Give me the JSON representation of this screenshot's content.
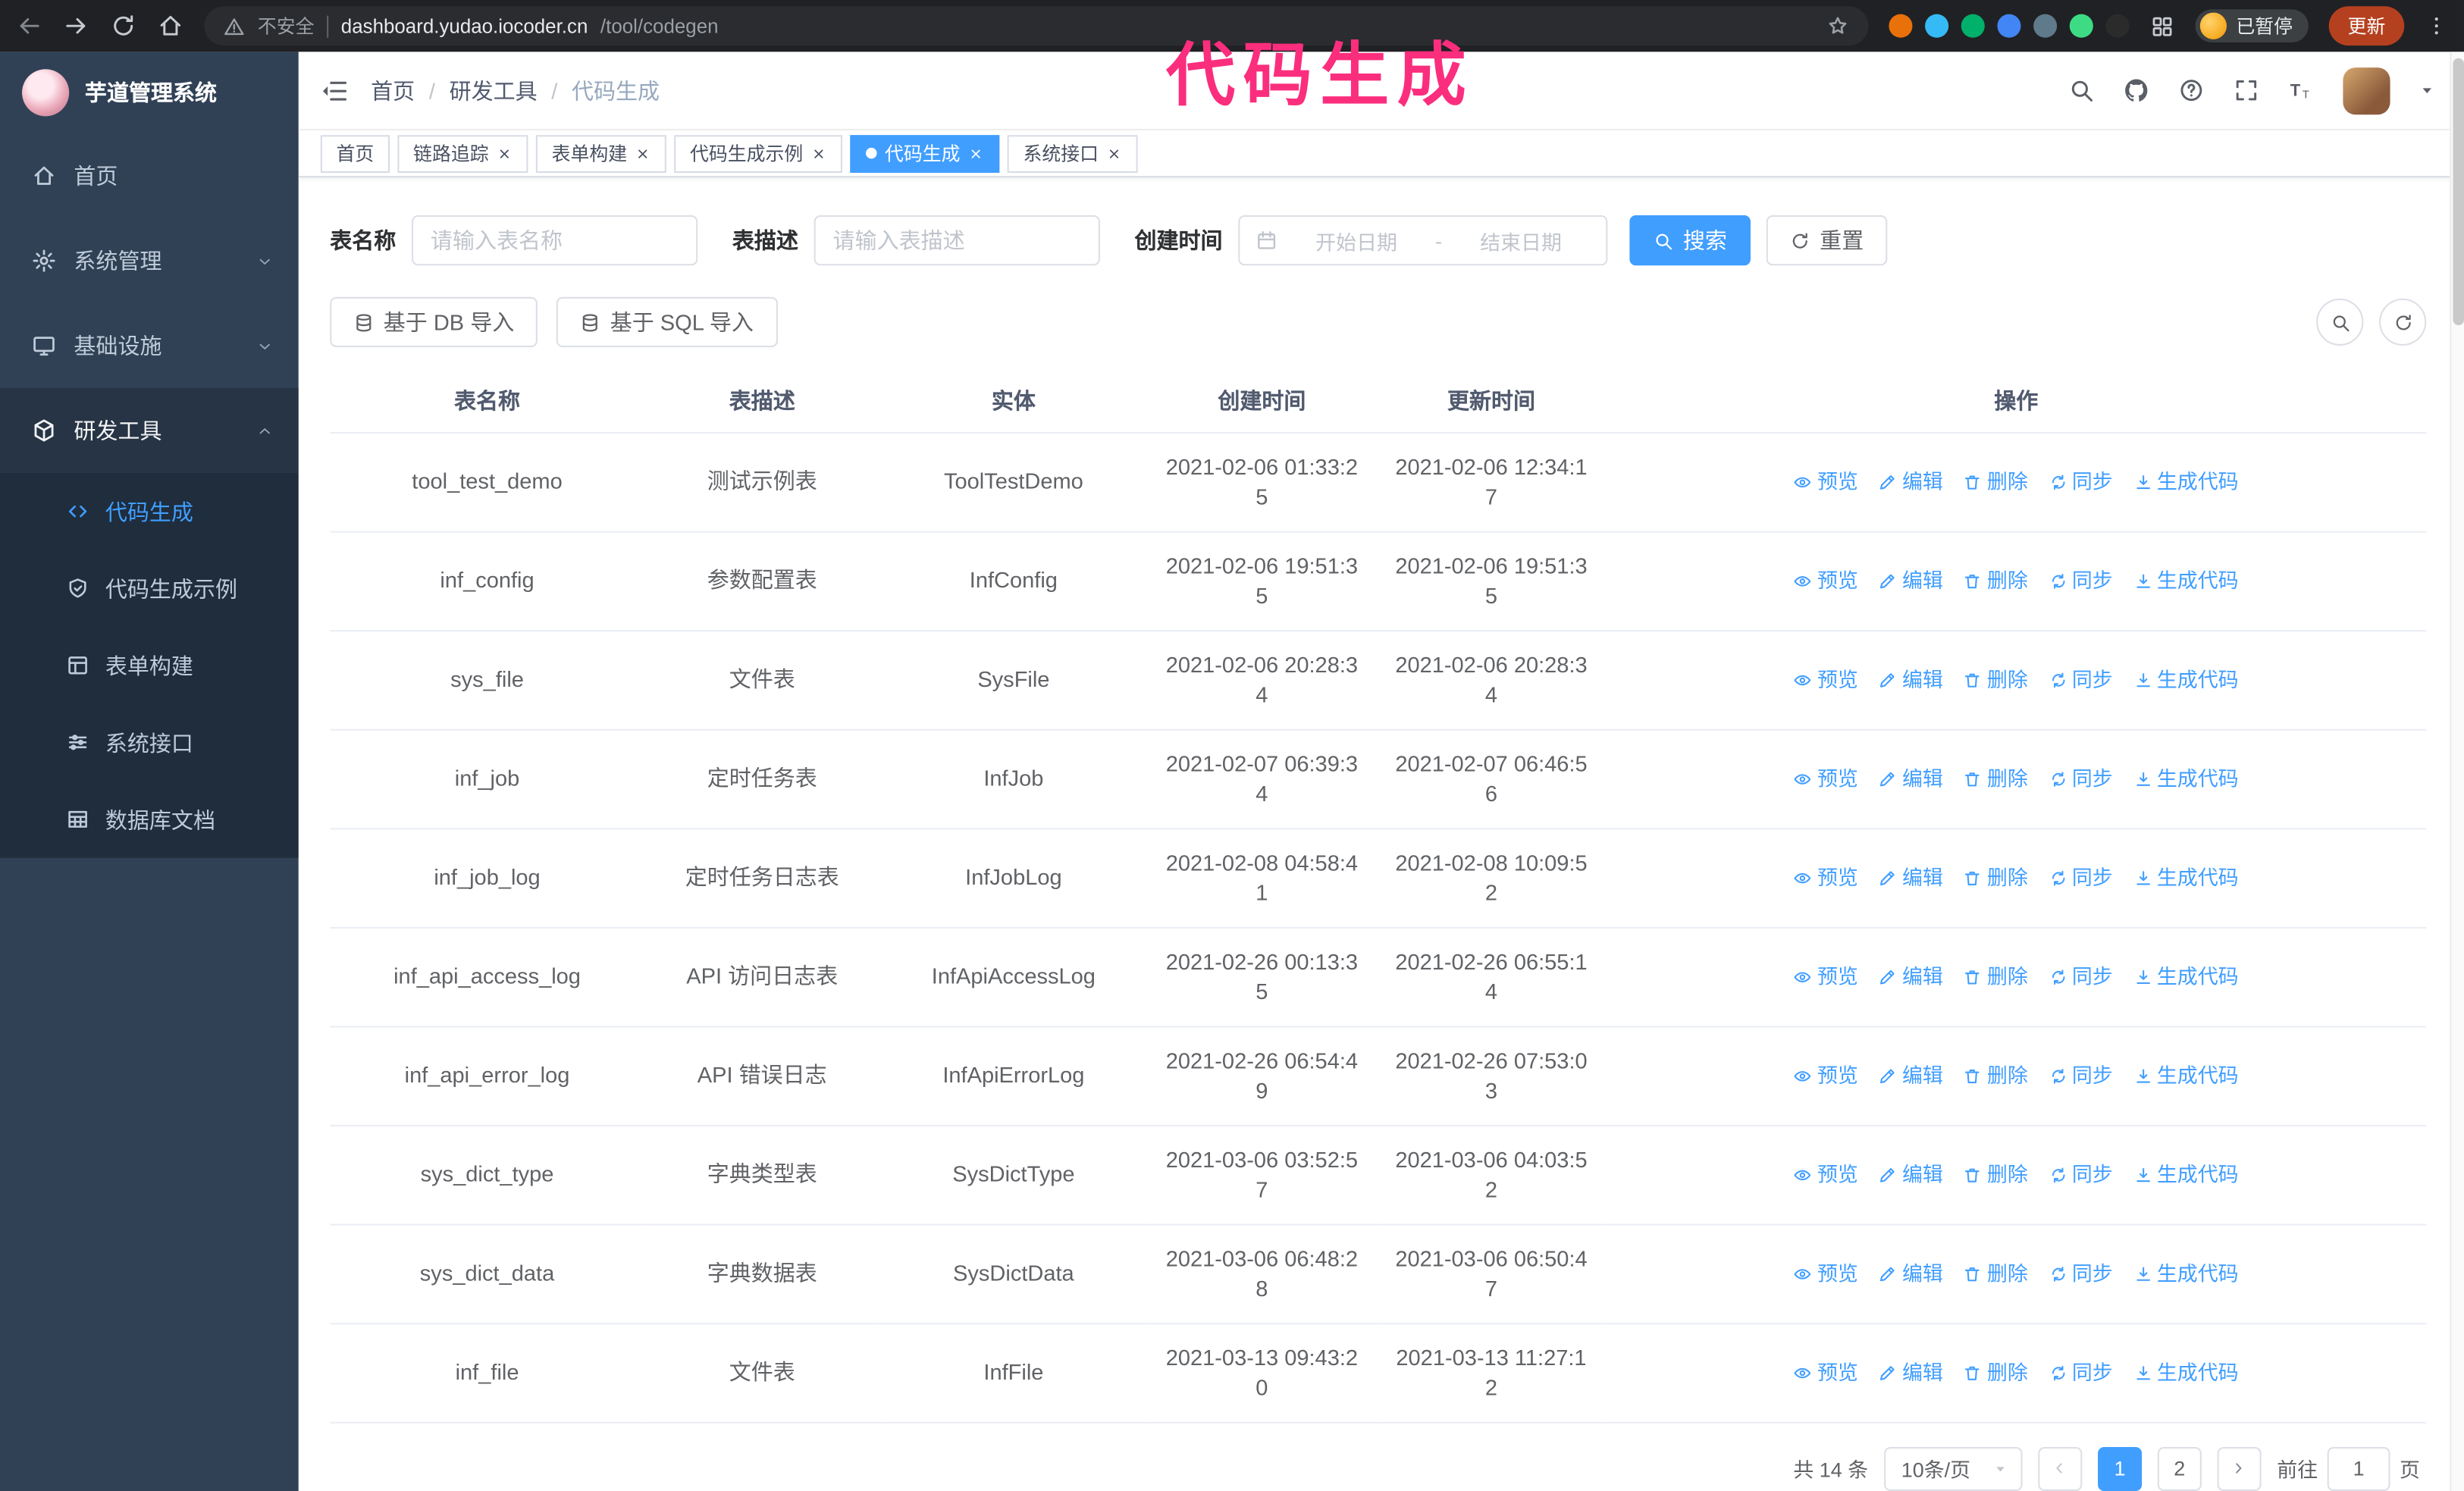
{
  "colors": {
    "accent": "#409eff",
    "sidebar_bg": "#304156",
    "submenu_bg": "#1f2d3d",
    "annotation": "#fb2e7e",
    "update_button_bg": "#b5401f"
  },
  "browser": {
    "security_label": "不安全",
    "url_host": "dashboard.yudao.iocoder.cn",
    "url_path": "/tool/codegen",
    "extensions": [
      {
        "name": "extension-icon",
        "color": "#e8710a"
      },
      {
        "name": "extension-icon",
        "color": "#35baf6"
      },
      {
        "name": "extension-icon",
        "color": "#00b06b"
      },
      {
        "name": "extension-icon",
        "color": "#4285f4"
      },
      {
        "name": "extension-icon",
        "color": "#5f7a8a"
      },
      {
        "name": "extension-icon",
        "color": "#3ddc84"
      },
      {
        "name": "extension-icon",
        "color": "#2b2b2b"
      }
    ],
    "profile_chip_label": "已暂停",
    "update_button_label": "更新"
  },
  "annotation": {
    "text": "代码生成",
    "color": "#fb2e7e"
  },
  "sidebar": {
    "logo_title": "芋道管理系统",
    "items": [
      {
        "icon": "home-icon",
        "label": "首页",
        "expandable": false,
        "expanded": false
      },
      {
        "icon": "gear-icon",
        "label": "系统管理",
        "expandable": true,
        "expanded": false
      },
      {
        "icon": "monitor-icon",
        "label": "基础设施",
        "expandable": true,
        "expanded": false
      },
      {
        "icon": "tools-icon",
        "label": "研发工具",
        "expandable": true,
        "expanded": true
      }
    ],
    "sub_items": [
      {
        "icon": "code-icon",
        "label": "代码生成",
        "active": true
      },
      {
        "icon": "example-icon",
        "label": "代码生成示例",
        "active": false
      },
      {
        "icon": "form-icon",
        "label": "表单构建",
        "active": false
      },
      {
        "icon": "api-icon",
        "label": "系统接口",
        "active": false
      },
      {
        "icon": "dbdoc-icon",
        "label": "数据库文档",
        "active": false
      }
    ]
  },
  "header": {
    "breadcrumb": [
      "首页",
      "研发工具",
      "代码生成"
    ],
    "separator": "/"
  },
  "tabs": [
    {
      "label": "首页",
      "closable": false,
      "active": false
    },
    {
      "label": "链路追踪",
      "closable": true,
      "active": false
    },
    {
      "label": "表单构建",
      "closable": true,
      "active": false
    },
    {
      "label": "代码生成示例",
      "closable": true,
      "active": false
    },
    {
      "label": "代码生成",
      "closable": true,
      "active": true
    },
    {
      "label": "系统接口",
      "closable": true,
      "active": false
    }
  ],
  "filters": {
    "table_name_label": "表名称",
    "table_name_placeholder": "请输入表名称",
    "table_desc_label": "表描述",
    "table_desc_placeholder": "请输入表描述",
    "create_time_label": "创建时间",
    "date_start_placeholder": "开始日期",
    "date_separator": "-",
    "date_end_placeholder": "结束日期",
    "search_button": "搜索",
    "reset_button": "重置"
  },
  "toolbar": {
    "import_db_label": "基于 DB 导入",
    "import_sql_label": "基于 SQL 导入"
  },
  "table": {
    "columns": [
      "表名称",
      "表描述",
      "实体",
      "创建时间",
      "更新时间",
      "操作"
    ],
    "actions": [
      {
        "name": "preview-action",
        "icon": "eye-icon",
        "label": "预览"
      },
      {
        "name": "edit-action",
        "icon": "edit-icon",
        "label": "编辑"
      },
      {
        "name": "delete-action",
        "icon": "delete-icon",
        "label": "删除"
      },
      {
        "name": "sync-action",
        "icon": "sync-icon",
        "label": "同步"
      },
      {
        "name": "generate-code-action",
        "icon": "generate-icon",
        "label": "生成代码"
      }
    ],
    "rows": [
      {
        "name": "tool_test_demo",
        "desc": "测试示例表",
        "entity": "ToolTestDemo",
        "created": "2021-02-06 01:33:25",
        "updated": "2021-02-06 12:34:17"
      },
      {
        "name": "inf_config",
        "desc": "参数配置表",
        "entity": "InfConfig",
        "created": "2021-02-06 19:51:35",
        "updated": "2021-02-06 19:51:35"
      },
      {
        "name": "sys_file",
        "desc": "文件表",
        "entity": "SysFile",
        "created": "2021-02-06 20:28:34",
        "updated": "2021-02-06 20:28:34"
      },
      {
        "name": "inf_job",
        "desc": "定时任务表",
        "entity": "InfJob",
        "created": "2021-02-07 06:39:34",
        "updated": "2021-02-07 06:46:56"
      },
      {
        "name": "inf_job_log",
        "desc": "定时任务日志表",
        "entity": "InfJobLog",
        "created": "2021-02-08 04:58:41",
        "updated": "2021-02-08 10:09:52"
      },
      {
        "name": "inf_api_access_log",
        "desc": "API 访问日志表",
        "entity": "InfApiAccessLog",
        "created": "2021-02-26 00:13:35",
        "updated": "2021-02-26 06:55:14"
      },
      {
        "name": "inf_api_error_log",
        "desc": "API 错误日志",
        "entity": "InfApiErrorLog",
        "created": "2021-02-26 06:54:49",
        "updated": "2021-02-26 07:53:03"
      },
      {
        "name": "sys_dict_type",
        "desc": "字典类型表",
        "entity": "SysDictType",
        "created": "2021-03-06 03:52:57",
        "updated": "2021-03-06 04:03:52"
      },
      {
        "name": "sys_dict_data",
        "desc": "字典数据表",
        "entity": "SysDictData",
        "created": "2021-03-06 06:48:28",
        "updated": "2021-03-06 06:50:47"
      },
      {
        "name": "inf_file",
        "desc": "文件表",
        "entity": "InfFile",
        "created": "2021-03-13 09:43:20",
        "updated": "2021-03-13 11:27:12"
      }
    ]
  },
  "pagination": {
    "total_text": "共 14 条",
    "page_size": "10条/页",
    "pages": [
      "1",
      "2"
    ],
    "active_page": "1",
    "goto_label": "前往",
    "goto_value": "1",
    "goto_suffix": "页"
  }
}
